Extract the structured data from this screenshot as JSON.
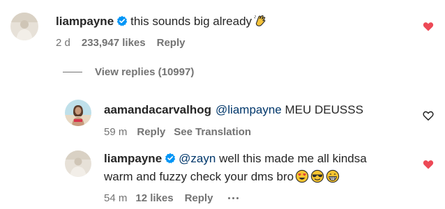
{
  "comment1": {
    "username": "liampayne",
    "text": "this sounds big already",
    "time": "2 d",
    "likes": "233,947 likes",
    "reply_label": "Reply",
    "liked": true
  },
  "view_replies": {
    "label": "View replies (10997)"
  },
  "reply1": {
    "username": "aamandacarvalhog",
    "mention": "@liampayne",
    "text": "MEU DEUSSS",
    "time": "59 m",
    "reply_label": "Reply",
    "translation_label": "See Translation",
    "liked": false
  },
  "reply2": {
    "username": "liampayne",
    "mention": "@zayn",
    "text_line1": "well this made me all kindsa",
    "text_line2": "warm and fuzzy check your dms bro",
    "time": "54 m",
    "likes": "12 likes",
    "reply_label": "Reply",
    "liked": true
  },
  "colors": {
    "heart_red": "#ed4956",
    "verified_blue": "#0095f6",
    "meta_gray": "#737373",
    "mention_blue": "#00376b"
  },
  "icons": {
    "verified": "verified-badge-icon",
    "heart": "heart-icon",
    "clap": "clapping-hands-emoji",
    "heart_eyes": "heart-eyes-emoji",
    "sunglasses": "sunglasses-emoji",
    "grin": "grinning-emoji"
  }
}
